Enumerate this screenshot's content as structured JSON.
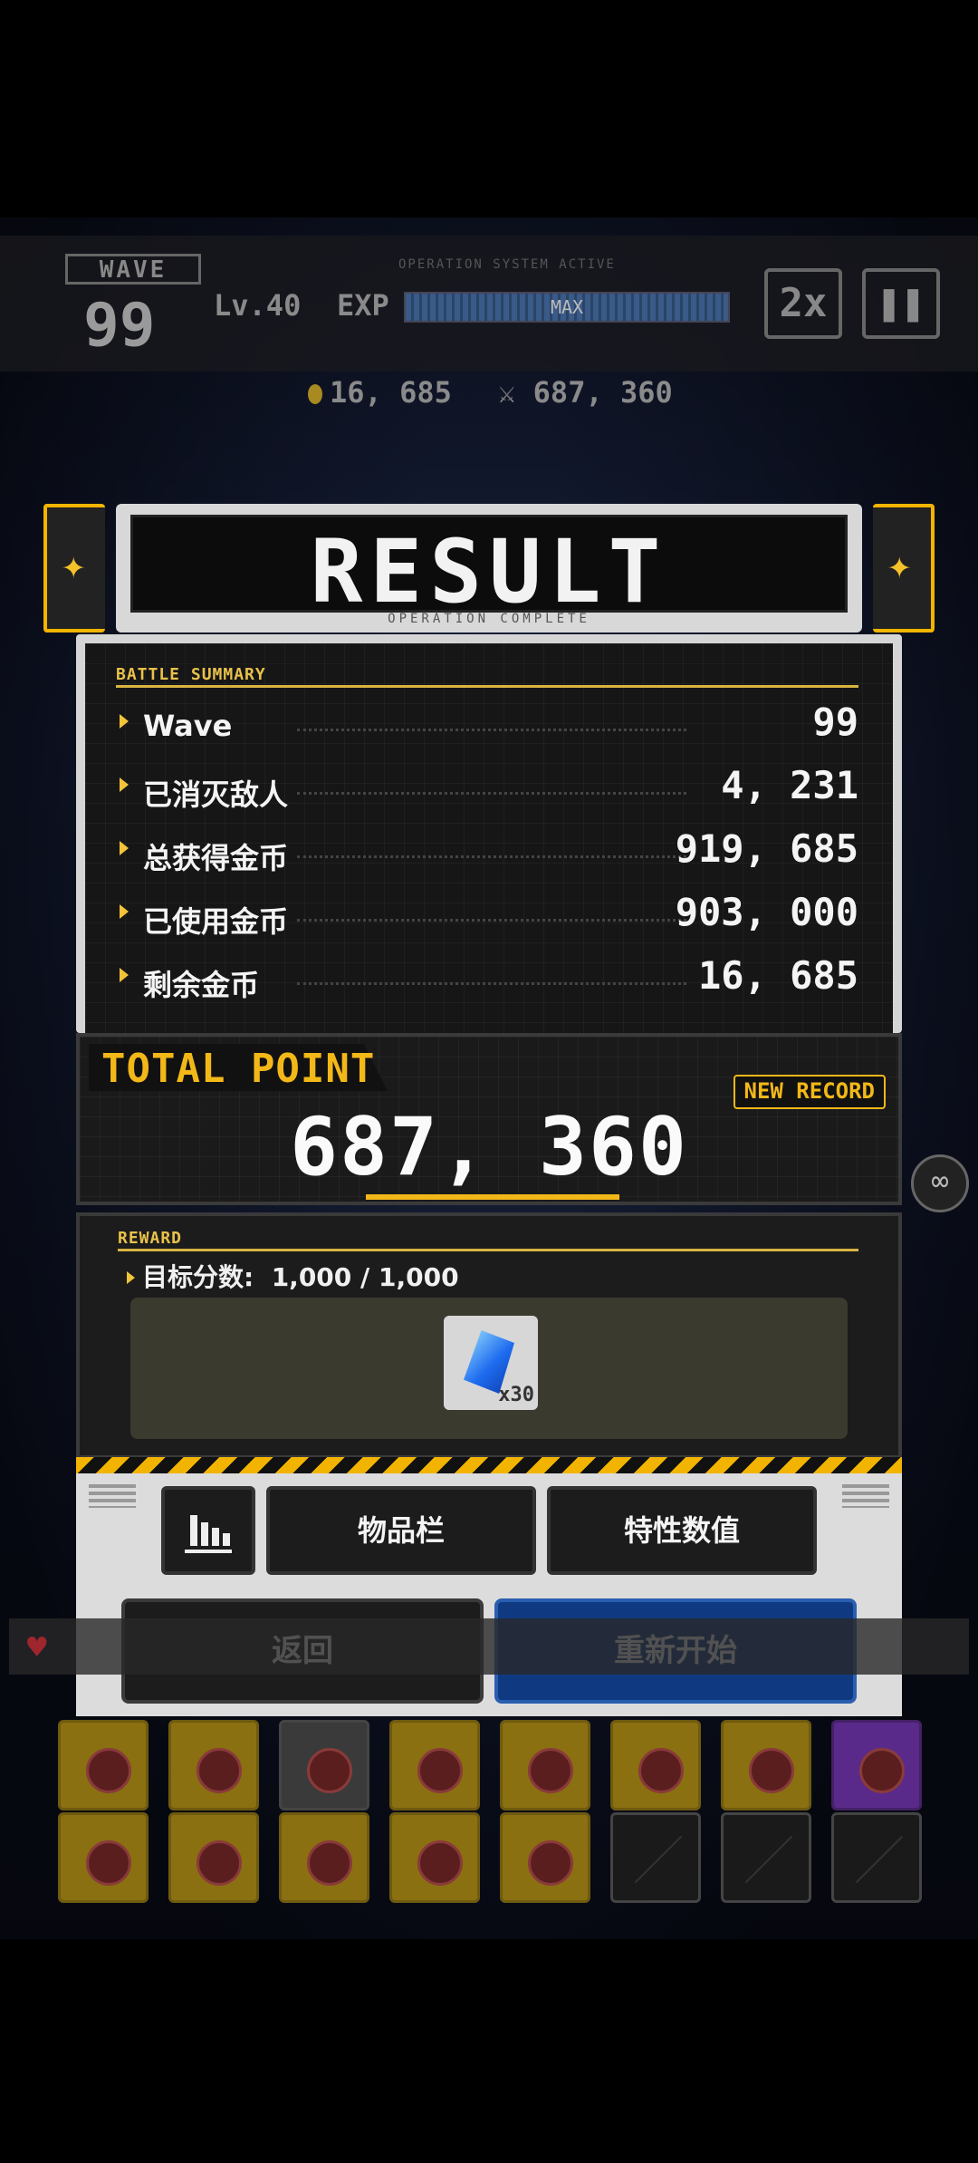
{
  "hud": {
    "wave_label": "WAVE",
    "wave_number": "99",
    "level": "Lv.40",
    "exp_label": "EXP",
    "exp_status": "MAX",
    "system_caption": "OPERATION SYSTEM ACTIVE",
    "speed": "2x",
    "gold": "16, 685",
    "score": "687, 360"
  },
  "result": {
    "title": "RESULT",
    "subtitle": "OPERATION COMPLETE"
  },
  "summary": {
    "label": "BATTLE SUMMARY",
    "rows": [
      {
        "label": "Wave",
        "value": "99"
      },
      {
        "label": "已消灭敌人",
        "value": "4, 231"
      },
      {
        "label": "总获得金币",
        "value": "919, 685"
      },
      {
        "label": "已使用金币",
        "value": "903, 000"
      },
      {
        "label": "剩余金币",
        "value": "16, 685"
      }
    ]
  },
  "total": {
    "label": "TOTAL POINT",
    "value": "687, 360",
    "badge": "NEW RECORD"
  },
  "reward": {
    "label": "REWARD",
    "target_label": "目标分数:",
    "target_value": "1,000 / 1,000",
    "item_icon": "blue-crystal-icon",
    "item_count": "x30"
  },
  "buttons": {
    "stats_icon": "bar-chart-icon",
    "inventory": "物品栏",
    "traits": "特性数值",
    "back": "返回",
    "restart": "重新开始"
  },
  "colors": {
    "accent": "#f2b818",
    "restart_button": "#0f3a82"
  }
}
